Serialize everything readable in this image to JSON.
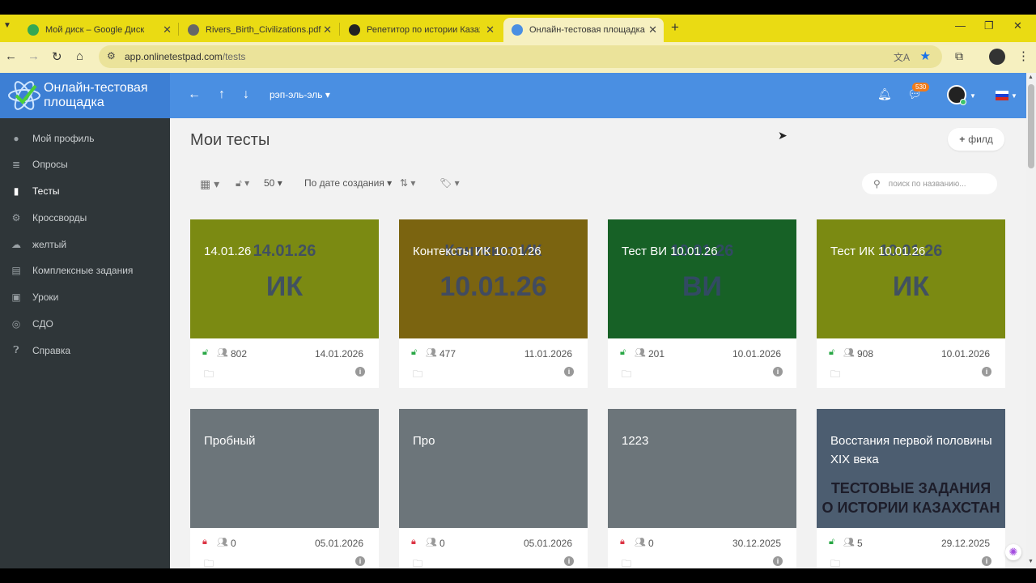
{
  "browser": {
    "tabs": [
      {
        "title": "Мой диск – Google Диск",
        "fav_color": "#34a853"
      },
      {
        "title": "Rivers_Birth_Civilizations.pdf",
        "fav_color": "#555555"
      },
      {
        "title": "Репетитор по истории Казахстана",
        "fav_color": "#222222"
      },
      {
        "title": "Онлайн-тестовая площадка",
        "fav_color": "#4a8fe2"
      }
    ],
    "url_host": "app.onlinetestpad.com",
    "url_path": "/tests"
  },
  "header": {
    "logo_text": "Онлайн-тестовая площадка",
    "user_select": "рэп-эль-эль ▾",
    "chat_badge": "530"
  },
  "sidebar": {
    "items": [
      {
        "label": "Мой профиль",
        "icon": "user-icon"
      },
      {
        "label": "Опросы",
        "icon": "list-icon"
      },
      {
        "label": "Тесты",
        "icon": "doc-icon",
        "active": true
      },
      {
        "label": "Кроссворды",
        "icon": "grid-icon"
      },
      {
        "label": "желтый",
        "icon": "chat-icon"
      },
      {
        "label": "Комплексные задания",
        "icon": "stack-icon"
      },
      {
        "label": "Уроки",
        "icon": "book-icon"
      },
      {
        "label": "СДО",
        "icon": "circle-icon"
      },
      {
        "label": "Справка",
        "icon": "help-icon"
      }
    ]
  },
  "main": {
    "title": "Мои тесты",
    "field_button": "филд",
    "per_page": "50",
    "sort_label": "По дате создания",
    "search_placeholder": "поиск по названию..."
  },
  "cards": [
    {
      "title": "14.01.26",
      "bg": "#7b8a12",
      "img_line1": "14.01.26",
      "img_line2": "ИК",
      "locked": false,
      "count": "802",
      "date": "14.01.2026"
    },
    {
      "title": "Контексты ИК 10.01.26",
      "bg": "#7b6410",
      "img_line1": "Контекст ИК",
      "img_line2": "10.01.26",
      "locked": false,
      "count": "477",
      "date": "11.01.2026"
    },
    {
      "title": "Тест ВИ 10.01.26",
      "bg": "#176126",
      "img_line1": "10.01.26",
      "img_line2": "ВИ",
      "locked": false,
      "count": "201",
      "date": "10.01.2026"
    },
    {
      "title": "Тест ИК 10.01.26",
      "bg": "#7b8a12",
      "img_line1": "10.01.26",
      "img_line2": "ИК",
      "locked": false,
      "count": "908",
      "date": "10.01.2026"
    },
    {
      "title": "Пробный",
      "bg": "#6c757a",
      "img_line1": "",
      "img_line2": "",
      "locked": true,
      "count": "0",
      "date": "05.01.2026"
    },
    {
      "title": "Про",
      "bg": "#6c757a",
      "img_line1": "",
      "img_line2": "",
      "locked": true,
      "count": "0",
      "date": "05.01.2026"
    },
    {
      "title": "1223",
      "bg": "#6c757a",
      "img_line1": "",
      "img_line2": "",
      "locked": true,
      "count": "0",
      "date": "30.12.2025"
    },
    {
      "title": "Восстания первой половины XIX века",
      "bg": "#4c5d70",
      "img_line1": "ТЕСТОВЫЕ ЗАДАНИЯ",
      "img_line2": "О ИСТОРИИ КАЗАХСТАН",
      "locked": false,
      "count": "5",
      "date": "29.12.2025"
    }
  ],
  "colors": {
    "lock_open": "#28a745",
    "lock_closed": "#dc3545"
  }
}
